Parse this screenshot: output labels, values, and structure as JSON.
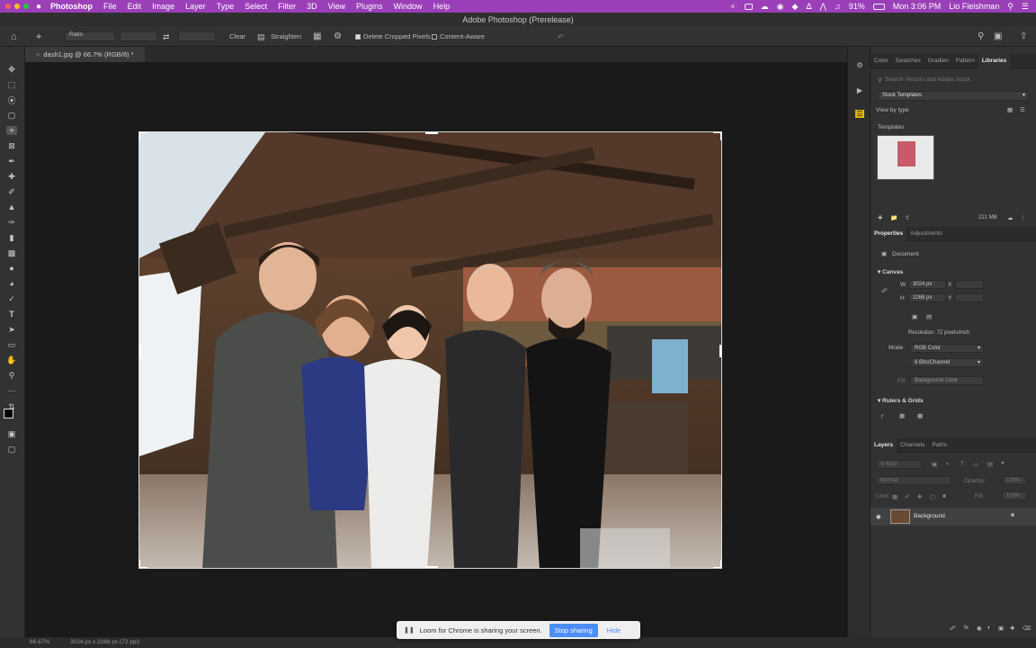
{
  "menubar": {
    "app_name": "Photoshop",
    "items": [
      "File",
      "Edit",
      "Image",
      "Layer",
      "Type",
      "Select",
      "Filter",
      "3D",
      "View",
      "Plugins",
      "Window",
      "Help"
    ],
    "battery": "91%",
    "clock": "Mon 3:06 PM",
    "user": "Lio Fleishman"
  },
  "window": {
    "title": "Adobe Photoshop (Prerelease)"
  },
  "options_bar": {
    "ratio_label": "Ratio",
    "clear_label": "Clear",
    "straighten_label": "Straighten",
    "delete_cropped_label": "Delete Cropped Pixels",
    "delete_cropped_checked": true,
    "content_aware_label": "Content-Aware",
    "content_aware_checked": false
  },
  "document_tab": {
    "label": "dash1.jpg @ 66.7% (RGB/8) *"
  },
  "libraries": {
    "tabs": [
      "Color",
      "Swatches",
      "Gradien",
      "Pattern",
      "Libraries"
    ],
    "active_tab": "Libraries",
    "search_placeholder": "Search Vectors and Adobe Stock",
    "source": "Stock Templates",
    "view_by": "View by type",
    "section": "Templates",
    "storage": "221 MB"
  },
  "properties": {
    "tabs": [
      "Properties",
      "Adjustments"
    ],
    "active_tab": "Properties",
    "doc_label": "Document",
    "canvas_header": "Canvas",
    "width_label": "W",
    "width_value": "3024 px",
    "x_label": "X",
    "height_label": "H",
    "height_value": "2268 px",
    "y_label": "Y",
    "resolution": "Resolution: 72 pixels/inch",
    "mode_label": "Mode",
    "mode_value": "RGB Color",
    "bits_value": "8 Bits/Channel",
    "fill_label": "Fill",
    "fill_value": "Background Color",
    "rulers_header": "Rulers & Grids"
  },
  "layers": {
    "tabs": [
      "Layers",
      "Channels",
      "Paths"
    ],
    "active_tab": "Layers",
    "kind_label": "Kind",
    "blend_mode": "Normal",
    "opacity_label": "Opacity:",
    "opacity_value": "100%",
    "lock_label": "Lock:",
    "fill_label": "Fill:",
    "fill_value": "100%",
    "layer_name": "Background"
  },
  "status": {
    "zoom": "66.67%",
    "doc_info": "3024 px x 2268 px (72 ppi)"
  },
  "loom": {
    "message": "Loom for Chrome is sharing your screen.",
    "stop_label": "Stop sharing",
    "hide_label": "Hide"
  },
  "colors": {
    "menubar": "#9a3fb8",
    "accent_blue": "#4c8df6",
    "panel_bg": "#323232",
    "canvas_bg": "#1a1a1a"
  }
}
